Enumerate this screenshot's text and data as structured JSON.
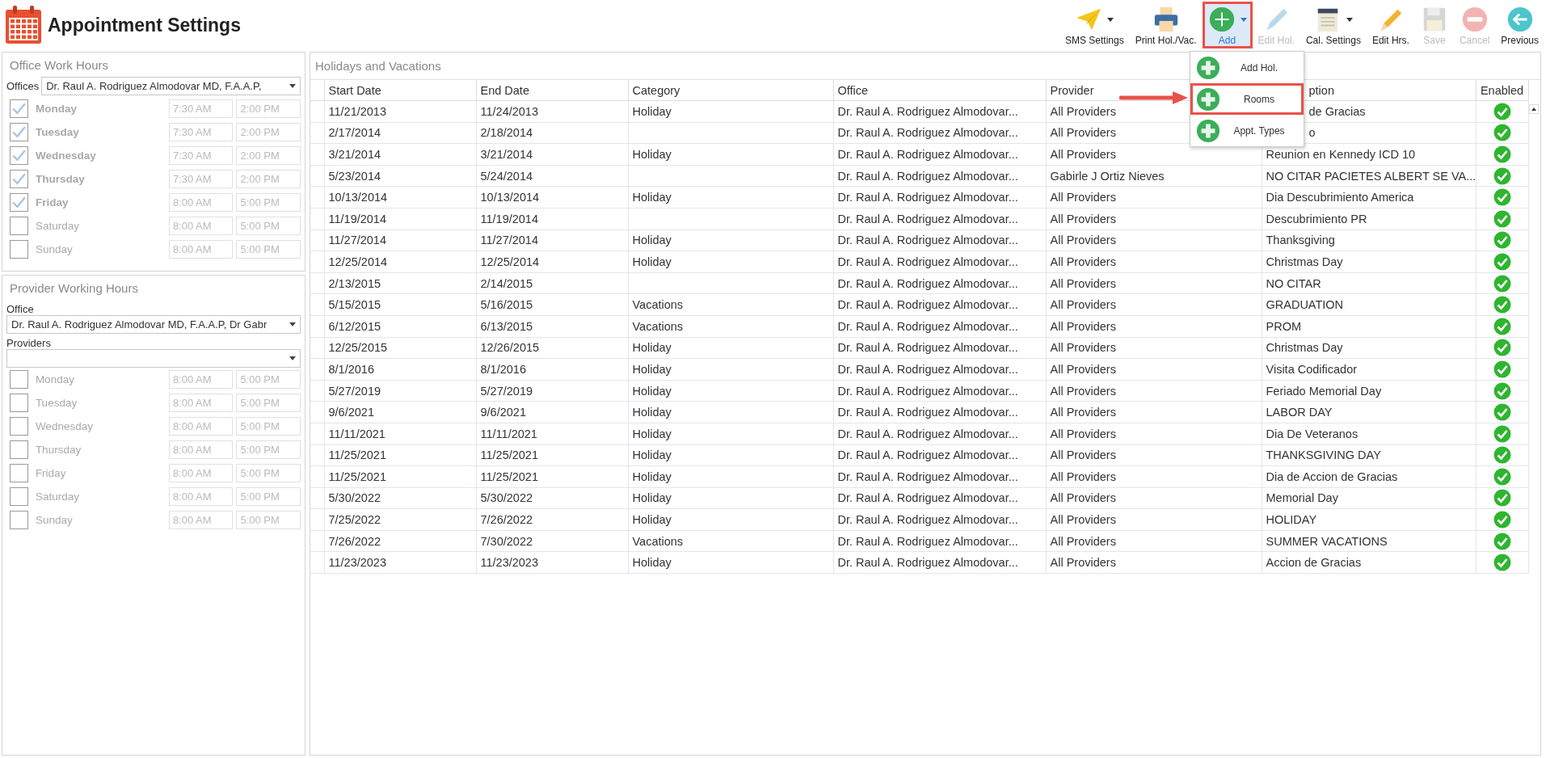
{
  "window": {
    "title": "Appointment Settings"
  },
  "toolbar": [
    {
      "label": "SMS Settings",
      "kind": "plane",
      "dropdown": true,
      "disabled": false,
      "selected": false,
      "highlighted": false
    },
    {
      "label": "Print Hol./Vac.",
      "kind": "printer",
      "dropdown": false,
      "disabled": false,
      "selected": false,
      "highlighted": false
    },
    {
      "label": "Add",
      "kind": "add",
      "dropdown": true,
      "disabled": false,
      "selected": true,
      "highlighted": true
    },
    {
      "label": "Edit Hol.",
      "kind": "pencil-blue",
      "dropdown": false,
      "disabled": true,
      "selected": false,
      "highlighted": false
    },
    {
      "label": "Cal. Settings",
      "kind": "notepad",
      "dropdown": true,
      "disabled": false,
      "selected": false,
      "highlighted": false
    },
    {
      "label": "Edit Hrs.",
      "kind": "pencil",
      "dropdown": false,
      "disabled": false,
      "selected": false,
      "highlighted": false
    },
    {
      "label": "Save",
      "kind": "floppy",
      "dropdown": false,
      "disabled": true,
      "selected": false,
      "highlighted": false
    },
    {
      "label": "Cancel",
      "kind": "minus",
      "dropdown": false,
      "disabled": true,
      "selected": false,
      "highlighted": false
    },
    {
      "label": "Previous",
      "kind": "back",
      "dropdown": false,
      "disabled": false,
      "selected": false,
      "highlighted": false
    }
  ],
  "add_menu": {
    "items": [
      {
        "label": "Add Hol.",
        "highlighted": false
      },
      {
        "label": "Rooms",
        "highlighted": true
      },
      {
        "label": "Appt. Types",
        "highlighted": false
      }
    ]
  },
  "office_work_hours": {
    "title": "Office Work Hours",
    "offices_label": "Offices",
    "office_value": "Dr. Raul A. Rodriguez Almodovar MD, F.A.A.P,",
    "days": [
      {
        "day": "Monday",
        "checked": true,
        "start": "7:30 AM",
        "end": "2:00 PM"
      },
      {
        "day": "Tuesday",
        "checked": true,
        "start": "7:30 AM",
        "end": "2:00 PM"
      },
      {
        "day": "Wednesday",
        "checked": true,
        "start": "7:30 AM",
        "end": "2:00 PM"
      },
      {
        "day": "Thursday",
        "checked": true,
        "start": "7:30 AM",
        "end": "2:00 PM"
      },
      {
        "day": "Friday",
        "checked": true,
        "start": "8:00 AM",
        "end": "5:00 PM"
      },
      {
        "day": "Saturday",
        "checked": false,
        "start": "8:00 AM",
        "end": "5:00 PM"
      },
      {
        "day": "Sunday",
        "checked": false,
        "start": "8:00 AM",
        "end": "5:00 PM"
      }
    ]
  },
  "provider_working_hours": {
    "title": "Provider Working Hours",
    "office_label": "Office",
    "office_value": "Dr. Raul A. Rodriguez Almodovar MD, F.A.A.P, Dr Gabr",
    "providers_label": "Providers",
    "days": [
      {
        "day": "Monday",
        "checked": false,
        "start": "8:00 AM",
        "end": "5:00 PM"
      },
      {
        "day": "Tuesday",
        "checked": false,
        "start": "8:00 AM",
        "end": "5:00 PM"
      },
      {
        "day": "Wednesday",
        "checked": false,
        "start": "8:00 AM",
        "end": "5:00 PM"
      },
      {
        "day": "Thursday",
        "checked": false,
        "start": "8:00 AM",
        "end": "5:00 PM"
      },
      {
        "day": "Friday",
        "checked": false,
        "start": "8:00 AM",
        "end": "5:00 PM"
      },
      {
        "day": "Saturday",
        "checked": false,
        "start": "8:00 AM",
        "end": "5:00 PM"
      },
      {
        "day": "Sunday",
        "checked": false,
        "start": "8:00 AM",
        "end": "5:00 PM"
      }
    ]
  },
  "holidays": {
    "title": "Holidays and Vacations",
    "columns": [
      {
        "label": "Start Date",
        "clipped": false
      },
      {
        "label": "End Date",
        "clipped": false
      },
      {
        "label": "Category",
        "clipped": false
      },
      {
        "label": "Office",
        "clipped": false
      },
      {
        "label": "Provider",
        "clipped": false
      },
      {
        "label": "ption",
        "clipped": true
      },
      {
        "label": "Enabled",
        "clipped": false
      }
    ],
    "rows": [
      {
        "start": "11/21/2013",
        "end": "11/24/2013",
        "category": "Holiday",
        "office": "Dr. Raul A. Rodriguez Almodovar...",
        "provider": "All Providers",
        "description": "de Gracias",
        "description_clipped": true,
        "enabled": true
      },
      {
        "start": "2/17/2014",
        "end": "2/18/2014",
        "category": "",
        "office": "Dr. Raul A. Rodriguez Almodovar...",
        "provider": "All Providers",
        "description": "o",
        "description_clipped": true,
        "enabled": true
      },
      {
        "start": "3/21/2014",
        "end": "3/21/2014",
        "category": "Holiday",
        "office": "Dr. Raul A. Rodriguez Almodovar...",
        "provider": "All Providers",
        "description": "Reunion en Kennedy ICD 10",
        "description_clipped": false,
        "enabled": true
      },
      {
        "start": "5/23/2014",
        "end": "5/24/2014",
        "category": "",
        "office": "Dr. Raul A. Rodriguez Almodovar...",
        "provider": "Gabirle J Ortiz Nieves",
        "description": "NO CITAR PACIETES ALBERT SE VA...",
        "description_clipped": false,
        "enabled": true
      },
      {
        "start": "10/13/2014",
        "end": "10/13/2014",
        "category": "Holiday",
        "office": "Dr. Raul A. Rodriguez Almodovar...",
        "provider": "All Providers",
        "description": "Dia Descubrimiento America",
        "description_clipped": false,
        "enabled": true
      },
      {
        "start": "11/19/2014",
        "end": "11/19/2014",
        "category": "",
        "office": "Dr. Raul A. Rodriguez Almodovar...",
        "provider": "All Providers",
        "description": "Descubrimiento PR",
        "description_clipped": false,
        "enabled": true
      },
      {
        "start": "11/27/2014",
        "end": "11/27/2014",
        "category": "Holiday",
        "office": "Dr. Raul A. Rodriguez Almodovar...",
        "provider": "All Providers",
        "description": "Thanksgiving",
        "description_clipped": false,
        "enabled": true
      },
      {
        "start": "12/25/2014",
        "end": "12/25/2014",
        "category": "Holiday",
        "office": "Dr. Raul A. Rodriguez Almodovar...",
        "provider": "All Providers",
        "description": "Christmas Day",
        "description_clipped": false,
        "enabled": true
      },
      {
        "start": "2/13/2015",
        "end": "2/14/2015",
        "category": "",
        "office": "Dr. Raul A. Rodriguez Almodovar...",
        "provider": "All Providers",
        "description": "NO CITAR",
        "description_clipped": false,
        "enabled": true
      },
      {
        "start": "5/15/2015",
        "end": "5/16/2015",
        "category": "Vacations",
        "office": "Dr. Raul A. Rodriguez Almodovar...",
        "provider": "All Providers",
        "description": "GRADUATION",
        "description_clipped": false,
        "enabled": true
      },
      {
        "start": "6/12/2015",
        "end": "6/13/2015",
        "category": "Vacations",
        "office": "Dr. Raul A. Rodriguez Almodovar...",
        "provider": "All Providers",
        "description": "PROM",
        "description_clipped": false,
        "enabled": true
      },
      {
        "start": "12/25/2015",
        "end": "12/26/2015",
        "category": "Holiday",
        "office": "Dr. Raul A. Rodriguez Almodovar...",
        "provider": "All Providers",
        "description": "Christmas Day",
        "description_clipped": false,
        "enabled": true
      },
      {
        "start": "8/1/2016",
        "end": "8/1/2016",
        "category": "Holiday",
        "office": "Dr. Raul A. Rodriguez Almodovar...",
        "provider": "All Providers",
        "description": "Visita Codificador",
        "description_clipped": false,
        "enabled": true
      },
      {
        "start": "5/27/2019",
        "end": "5/27/2019",
        "category": "Holiday",
        "office": "Dr. Raul A. Rodriguez Almodovar...",
        "provider": "All Providers",
        "description": "Feriado Memorial Day",
        "description_clipped": false,
        "enabled": true
      },
      {
        "start": "9/6/2021",
        "end": "9/6/2021",
        "category": "Holiday",
        "office": "Dr. Raul A. Rodriguez Almodovar...",
        "provider": "All Providers",
        "description": "LABOR DAY",
        "description_clipped": false,
        "enabled": true
      },
      {
        "start": "11/11/2021",
        "end": "11/11/2021",
        "category": "Holiday",
        "office": "Dr. Raul A. Rodriguez Almodovar...",
        "provider": "All Providers",
        "description": "Dia De Veteranos",
        "description_clipped": false,
        "enabled": true
      },
      {
        "start": "11/25/2021",
        "end": "11/25/2021",
        "category": "Holiday",
        "office": "Dr. Raul A. Rodriguez Almodovar...",
        "provider": "All Providers",
        "description": "THANKSGIVING DAY",
        "description_clipped": false,
        "enabled": true
      },
      {
        "start": "11/25/2021",
        "end": "11/25/2021",
        "category": "Holiday",
        "office": "Dr. Raul A. Rodriguez Almodovar...",
        "provider": "All Providers",
        "description": "Dia de Accion de Gracias",
        "description_clipped": false,
        "enabled": true
      },
      {
        "start": "5/30/2022",
        "end": "5/30/2022",
        "category": "Holiday",
        "office": "Dr. Raul A. Rodriguez Almodovar...",
        "provider": "All Providers",
        "description": "Memorial Day",
        "description_clipped": false,
        "enabled": true
      },
      {
        "start": "7/25/2022",
        "end": "7/26/2022",
        "category": "Holiday",
        "office": "Dr. Raul A. Rodriguez Almodovar...",
        "provider": "All Providers",
        "description": "HOLIDAY",
        "description_clipped": false,
        "enabled": true
      },
      {
        "start": "7/26/2022",
        "end": "7/30/2022",
        "category": "Vacations",
        "office": "Dr. Raul A. Rodriguez Almodovar...",
        "provider": "All Providers",
        "description": "SUMMER VACATIONS",
        "description_clipped": false,
        "enabled": true
      },
      {
        "start": "11/23/2023",
        "end": "11/23/2023",
        "category": "Holiday",
        "office": "Dr. Raul A. Rodriguez Almodovar...",
        "provider": "All Providers",
        "description": "Accion de Gracias",
        "description_clipped": false,
        "enabled": true
      }
    ]
  }
}
